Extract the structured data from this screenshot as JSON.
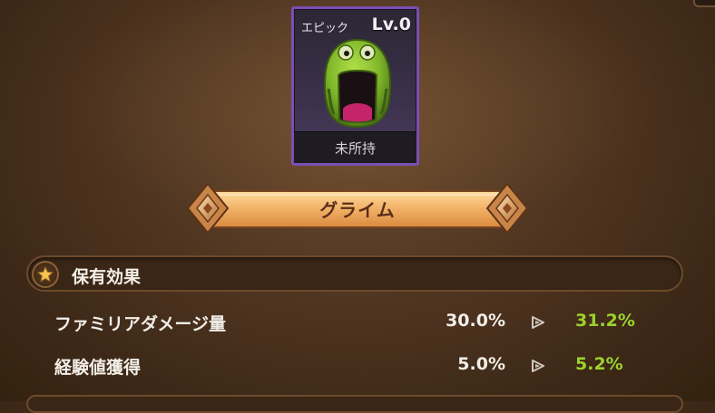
{
  "card": {
    "rarity": "エピック",
    "level": "Lv.0",
    "owned_status": "未所持",
    "border_color": "#7a4fb5",
    "monster_icon": "green-slime-monster"
  },
  "banner": {
    "name": "グライム"
  },
  "effects": {
    "icon": "star-icon",
    "title": "保有効果",
    "rows": [
      {
        "label": "ファミリアダメージ量",
        "current": "30.0%",
        "next": "31.2%"
      },
      {
        "label": "経験値獲得",
        "current": "5.0%",
        "next": "5.2%"
      }
    ],
    "next_color": "#9bd22d"
  }
}
